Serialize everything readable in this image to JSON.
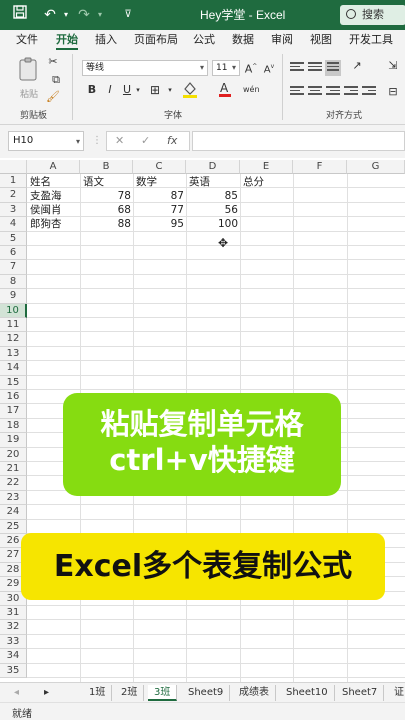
{
  "titlebar": {
    "title": "Hey学堂 - Excel",
    "search_label": "搜索"
  },
  "ribbon": {
    "tabs": [
      "文件",
      "开始",
      "插入",
      "页面布局",
      "公式",
      "数据",
      "审阅",
      "视图",
      "开发工具"
    ],
    "active_tab": "开始",
    "paste_label": "粘贴",
    "clipboard_label": "剪贴板",
    "font_name": "等线",
    "font_size": "11",
    "font_group_label": "字体",
    "align_group_label": "对齐方式",
    "bold": "B",
    "italic": "I",
    "underline": "U"
  },
  "formula_bar": {
    "name_box": "H10",
    "fx": "fx",
    "value": ""
  },
  "grid": {
    "columns": [
      "A",
      "B",
      "C",
      "D",
      "E",
      "F",
      "G"
    ],
    "selected_row": 10,
    "rows": [
      [
        "姓名",
        "语文",
        "数学",
        "英语",
        "总分"
      ],
      [
        "支盈海",
        "78",
        "87",
        "85",
        ""
      ],
      [
        "侯闽肖",
        "68",
        "77",
        "56",
        ""
      ],
      [
        "郎狗杏",
        "88",
        "95",
        "100",
        ""
      ]
    ]
  },
  "overlay": {
    "banner1_line1": "粘贴复制单元格",
    "banner1_line2": "ctrl+v快捷键",
    "banner2": "Excel多个表复制公式"
  },
  "sheets": {
    "tabs": [
      "1班",
      "2班",
      "3班",
      "Sheet9",
      "成绩表",
      "Sheet10",
      "Sheet7",
      "证"
    ],
    "active": "3班"
  },
  "status": {
    "ready": "就绪"
  }
}
